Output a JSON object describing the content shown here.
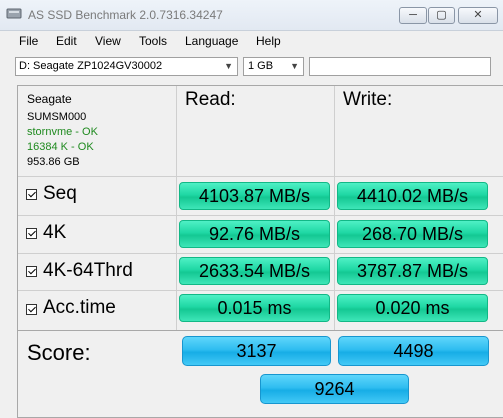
{
  "window": {
    "title": "AS SSD Benchmark 2.0.7316.34247",
    "min": "─",
    "max": "▢",
    "close": "✕"
  },
  "menu": [
    "File",
    "Edit",
    "View",
    "Tools",
    "Language",
    "Help"
  ],
  "toolbar": {
    "drive": "D: Seagate ZP1024GV30002",
    "size": "1 GB",
    "free_text": ""
  },
  "drive_info": {
    "vendor": "Seagate",
    "firmware": "SUMSM000",
    "driver": "stornvme - OK",
    "alignment": "16384 K - OK",
    "capacity": "953.86 GB"
  },
  "columns": {
    "read": "Read:",
    "write": "Write:"
  },
  "tests": [
    {
      "label": "Seq",
      "read": "4103.87 MB/s",
      "write": "4410.02 MB/s"
    },
    {
      "label": "4K",
      "read": "92.76 MB/s",
      "write": "268.70 MB/s"
    },
    {
      "label": "4K-64Thrd",
      "read": "2633.54 MB/s",
      "write": "3787.87 MB/s"
    },
    {
      "label": "Acc.time",
      "read": "0.015 ms",
      "write": "0.020 ms"
    }
  ],
  "score": {
    "label": "Score:",
    "read": "3137",
    "write": "4498",
    "total": "9264"
  },
  "colors": {
    "result_green": "#1fd8a4",
    "score_blue": "#2fbdf0",
    "ok_green": "#1f8a1f"
  }
}
